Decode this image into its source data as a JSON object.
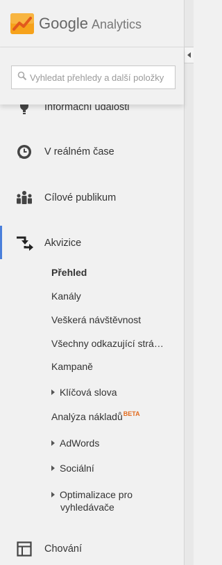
{
  "header": {
    "brand_google": "Google",
    "brand_analytics": "Analytics"
  },
  "search": {
    "placeholder": "Vyhledat přehledy a další položky"
  },
  "nav": {
    "info_events": "Informační události",
    "realtime": "V reálném čase",
    "audience": "Cílové publikum",
    "acquisition": "Akvizice",
    "behavior": "Chování"
  },
  "acquisition_sub": {
    "overview": "Přehled",
    "channels": "Kanály",
    "all_traffic": "Veškerá návštěvnost",
    "all_referrals": "Všechny odkazující strá…",
    "campaigns": "Kampaně",
    "keywords": "Klíčová slova",
    "cost_analysis": "Analýza nákladů",
    "beta": "BETA",
    "adwords": "AdWords",
    "social": "Sociální",
    "seo_line1": "Optimalizace pro",
    "seo_line2": "vyhledávače"
  },
  "colors": {
    "accent": "#4a7fdb",
    "beta": "#e26b1e",
    "logo_orange": "#f5a623"
  },
  "icons": [
    "analytics-logo-icon",
    "search-icon",
    "lightbulb-icon",
    "clock-icon",
    "people-icon",
    "arrows-icon",
    "layout-icon",
    "collapse-icon"
  ]
}
